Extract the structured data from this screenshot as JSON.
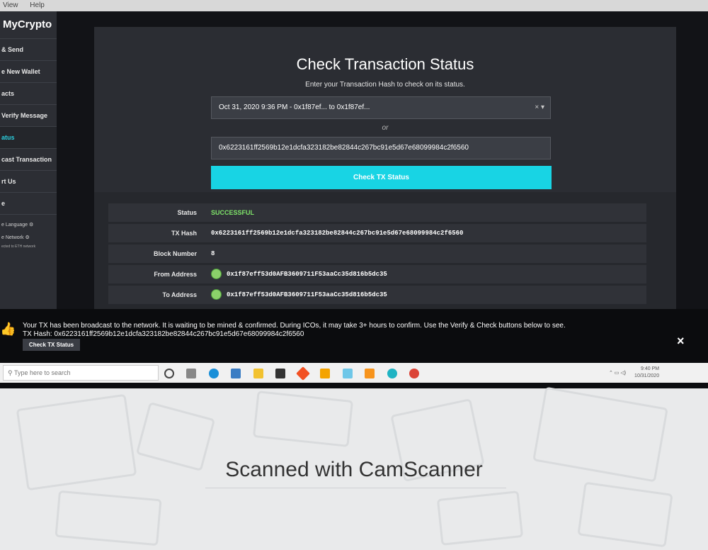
{
  "menubar": {
    "items": [
      "View",
      "Help"
    ]
  },
  "sidebar": {
    "brand": "MyCrypto",
    "items": [
      "& Send",
      "e New Wallet",
      "acts",
      "Verify Message",
      "atus",
      "cast Transaction",
      "rt Us",
      "e"
    ],
    "active_index": 4,
    "settings": [
      "e Language",
      "e Network"
    ],
    "network_note": "ected to ETH network"
  },
  "panel": {
    "title": "Check Transaction Status",
    "subtitle": "Enter your Transaction Hash to check on its status.",
    "select_value": "Oct 31, 2020 9:36 PM - 0x1f87ef... to 0x1f87ef...",
    "select_controls": "× ▾",
    "or_label": "or",
    "hash_value": "0x6223161ff2569b12e1dcfa323182be82844c267bc91e5d67e68099984c2f6560",
    "button_label": "Check TX Status"
  },
  "details": {
    "status_label": "Status",
    "status_value": "SUCCESSFUL",
    "txhash_label": "TX Hash",
    "txhash_value": "0x6223161ff2569b12e1dcfa323182be82844c267bc91e5d67e68099984c2f6560",
    "block_label": "Block Number",
    "block_value": "8",
    "from_label": "From Address",
    "from_value": "0x1f87eff53d0AFB3609711F53aaCc35d816b5dc35",
    "to_label": "To Address",
    "to_value": "0x1f87eff53d0AFB3609711F53aaCc35d816b5dc35"
  },
  "notice": {
    "line1": "Your TX has been broadcast to the network. It is waiting to be mined & confirmed. During ICOs, it may take 3+ hours to confirm. Use the Verify & Check buttons below to see.",
    "line2": "TX Hash: 0x6223161ff2569b12e1dcfa323182be82844c267bc91e5d67e68099984c2f6560",
    "button": "Check TX Status",
    "close": "×"
  },
  "taskbar": {
    "search_placeholder": "Type here to search",
    "time": "9:40 PM",
    "date": "10/31/2020",
    "tray": "⌃ ▭ ◁)"
  },
  "watermark": {
    "text": "Scanned with CamScanner"
  }
}
